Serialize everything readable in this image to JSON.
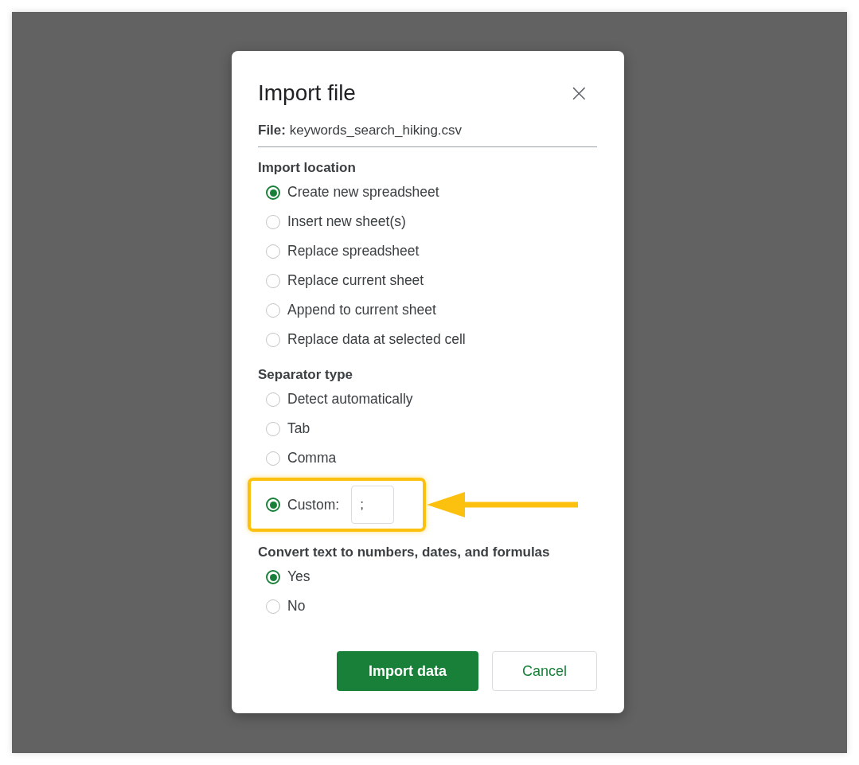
{
  "dialog": {
    "title": "Import file",
    "close_icon": "×",
    "file_label": "File:",
    "file_name": "keywords_search_hiking.csv",
    "groups": [
      {
        "title": "Import location",
        "options": [
          {
            "kind": "radio",
            "label": "Create new spreadsheet",
            "selected": true
          },
          {
            "kind": "radio",
            "label": "Insert new sheet(s)",
            "selected": false
          },
          {
            "kind": "radio",
            "label": "Replace spreadsheet",
            "selected": false
          },
          {
            "kind": "radio",
            "label": "Replace current sheet",
            "selected": false
          },
          {
            "kind": "radio",
            "label": "Append to current sheet",
            "selected": false
          },
          {
            "kind": "radio",
            "label": "Replace data at selected cell",
            "selected": false
          }
        ]
      },
      {
        "title": "Separator type",
        "options": [
          {
            "kind": "radio",
            "label": "Detect automatically",
            "selected": false
          },
          {
            "kind": "radio",
            "label": "Tab",
            "selected": false
          },
          {
            "kind": "radio",
            "label": "Comma",
            "selected": false
          },
          {
            "kind": "custom",
            "label": "Custom:",
            "value": ";",
            "selected": true,
            "highlighted": true
          }
        ]
      },
      {
        "title": "Convert text to numbers, dates, and formulas",
        "options": [
          {
            "kind": "radio",
            "label": "Yes",
            "selected": true
          },
          {
            "kind": "radio",
            "label": "No",
            "selected": false
          }
        ]
      }
    ],
    "buttons": [
      {
        "kind": "primary",
        "label": "Import data"
      },
      {
        "kind": "secondary",
        "label": "Cancel"
      }
    ]
  }
}
